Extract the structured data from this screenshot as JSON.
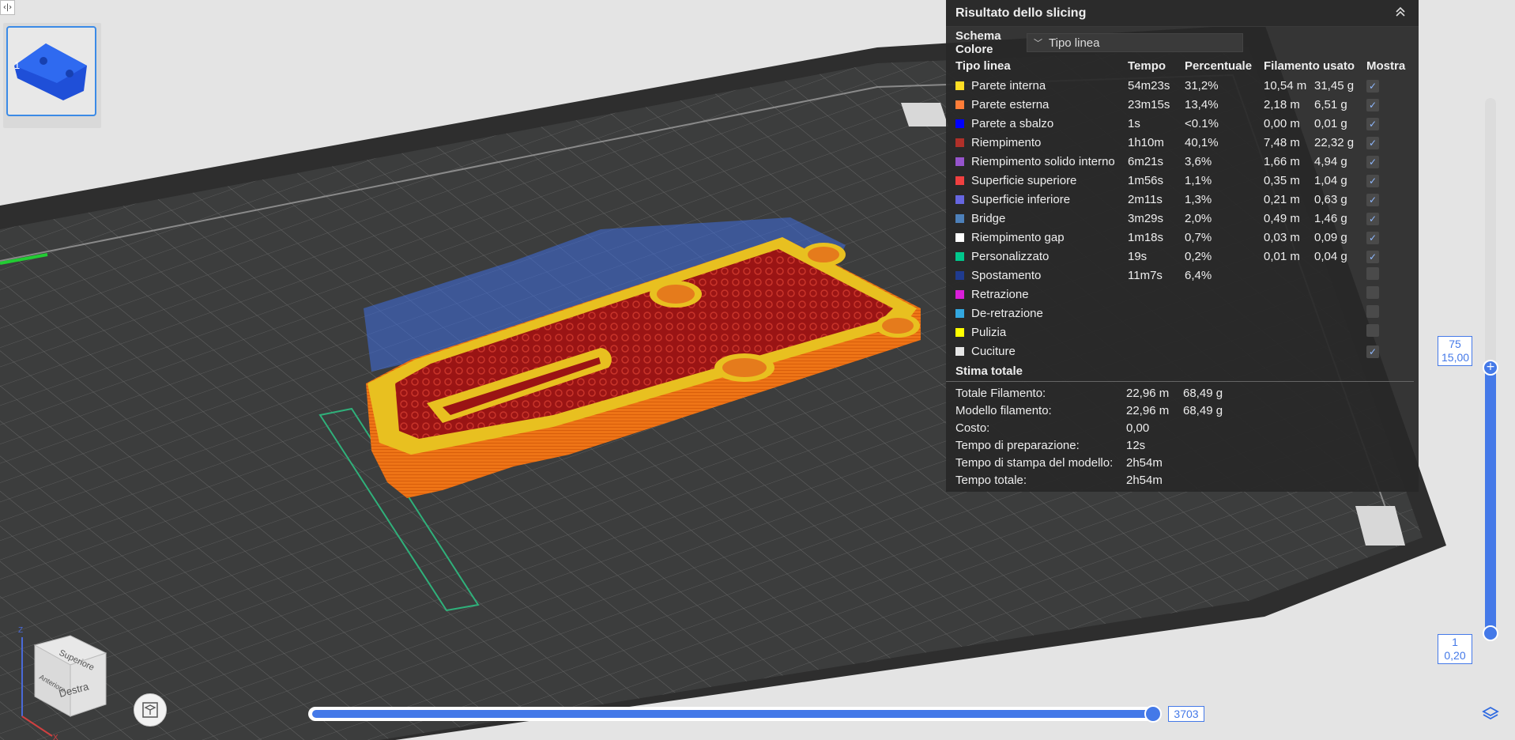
{
  "top_toggle": {
    "glyph": "‹|›"
  },
  "thumbnail": {
    "plate_number": "1"
  },
  "panel": {
    "title": "Risultato dello slicing",
    "collapse_icon": "chevrons-up-icon",
    "scheme_label": "Schema Colore",
    "scheme_value": "Tipo linea",
    "columns": [
      "Tipo linea",
      "Tempo",
      "Percentuale",
      "Filamento usato",
      "Mostra"
    ],
    "rows": [
      {
        "color": "#ffde24",
        "name": "Parete interna",
        "time": "54m23s",
        "percent": "31,2%",
        "length": "10,54 m",
        "weight": "31,45 g",
        "shown": true,
        "checked": true
      },
      {
        "color": "#ff7d38",
        "name": "Parete esterna",
        "time": "23m15s",
        "percent": "13,4%",
        "length": "2,18 m",
        "weight": "6,51 g",
        "shown": true,
        "checked": true
      },
      {
        "color": "#0000ff",
        "name": "Parete a sbalzo",
        "time": "1s",
        "percent": "<0.1%",
        "length": "0,00 m",
        "weight": "0,01 g",
        "shown": true,
        "checked": true
      },
      {
        "color": "#b03029",
        "name": "Riempimento",
        "time": "1h10m",
        "percent": "40,1%",
        "length": "7,48 m",
        "weight": "22,32 g",
        "shown": true,
        "checked": true
      },
      {
        "color": "#9654cc",
        "name": "Riempimento solido interno",
        "time": "6m21s",
        "percent": "3,6%",
        "length": "1,66 m",
        "weight": "4,94 g",
        "shown": true,
        "checked": true
      },
      {
        "color": "#f04040",
        "name": "Superficie superiore",
        "time": "1m56s",
        "percent": "1,1%",
        "length": "0,35 m",
        "weight": "1,04 g",
        "shown": true,
        "checked": true
      },
      {
        "color": "#6666e0",
        "name": "Superficie inferiore",
        "time": "2m11s",
        "percent": "1,3%",
        "length": "0,21 m",
        "weight": "0,63 g",
        "shown": true,
        "checked": true
      },
      {
        "color": "#4d80ba",
        "name": "Bridge",
        "time": "3m29s",
        "percent": "2,0%",
        "length": "0,49 m",
        "weight": "1,46 g",
        "shown": true,
        "checked": true
      },
      {
        "color": "#ffffff",
        "name": "Riempimento gap",
        "time": "1m18s",
        "percent": "0,7%",
        "length": "0,03 m",
        "weight": "0,09 g",
        "shown": true,
        "checked": true
      },
      {
        "color": "#00c88c",
        "name": "Personalizzato",
        "time": "19s",
        "percent": "0,2%",
        "length": "0,01 m",
        "weight": "0,04 g",
        "shown": true,
        "checked": true
      },
      {
        "color": "#1f3b8f",
        "name": "Spostamento",
        "time": "11m7s",
        "percent": "6,4%",
        "length": "",
        "weight": "",
        "shown": true,
        "checked": false
      },
      {
        "color": "#d91ed9",
        "name": "Retrazione",
        "time": "",
        "percent": "",
        "length": "",
        "weight": "",
        "shown": true,
        "checked": false
      },
      {
        "color": "#33a8e0",
        "name": "De-retrazione",
        "time": "",
        "percent": "",
        "length": "",
        "weight": "",
        "shown": true,
        "checked": false
      },
      {
        "color": "#ffff00",
        "name": "Pulizia",
        "time": "",
        "percent": "",
        "length": "",
        "weight": "",
        "shown": true,
        "checked": false
      },
      {
        "color": "#e6e6e6",
        "name": "Cuciture",
        "time": "",
        "percent": "",
        "length": "",
        "weight": "",
        "shown": true,
        "checked": true
      }
    ],
    "total_title": "Stima totale",
    "totals": [
      {
        "label": "Totale Filamento:",
        "v1": "22,96 m",
        "v2": "68,49 g"
      },
      {
        "label": "Modello filamento:",
        "v1": "22,96 m",
        "v2": "68,49 g"
      },
      {
        "label": "Costo:",
        "v1": "0,00",
        "v2": ""
      },
      {
        "label": "Tempo di preparazione:",
        "v1": "12s",
        "v2": ""
      },
      {
        "label": "Tempo di stampa del modello:",
        "v1": "2h54m",
        "v2": ""
      },
      {
        "label": "Tempo totale:",
        "v1": "2h54m",
        "v2": ""
      }
    ]
  },
  "layer_slider": {
    "top_layer": "75",
    "top_height": "15,00",
    "bottom_layer": "1",
    "bottom_height": "0,20"
  },
  "move_slider": {
    "value": "3703"
  },
  "navcube": {
    "top": "Superiore",
    "front": "Anteriore",
    "right": "Destra",
    "axis_z": "Z",
    "axis_x": "X"
  },
  "colors": {
    "accent": "#4479e8",
    "panel_bg": "#282828",
    "orange": "#f07018",
    "infill": "#a01818"
  }
}
